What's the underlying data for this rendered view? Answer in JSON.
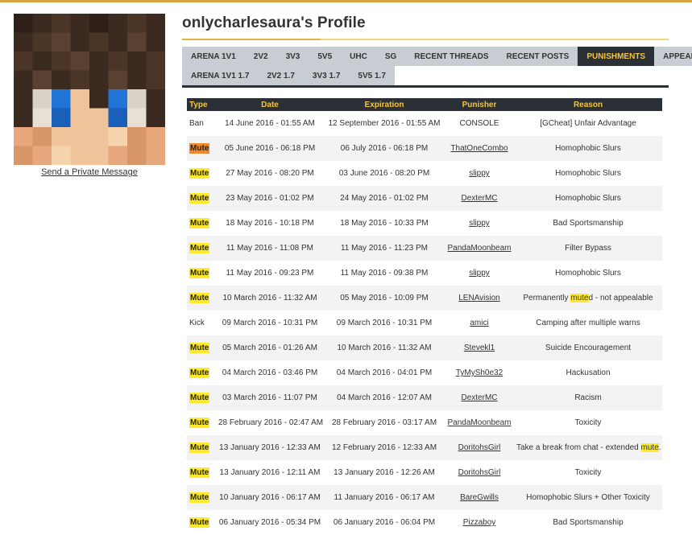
{
  "profile": {
    "title": "onlycharlesaura's Profile",
    "pm_link": "Send a Private Message"
  },
  "tabs_row1": [
    {
      "label": "ARENA 1V1",
      "active": false
    },
    {
      "label": "2V2",
      "active": false
    },
    {
      "label": "3V3",
      "active": false
    },
    {
      "label": "5V5",
      "active": false
    },
    {
      "label": "UHC",
      "active": false
    },
    {
      "label": "SG",
      "active": false
    },
    {
      "label": "RECENT THREADS",
      "active": false
    },
    {
      "label": "RECENT POSTS",
      "active": false
    },
    {
      "label": "PUNISHMENTS",
      "active": true
    },
    {
      "label": "APPEALS",
      "active": false
    }
  ],
  "tabs_row2": [
    {
      "label": "ARENA 1V1 1.7"
    },
    {
      "label": "2V2 1.7"
    },
    {
      "label": "3V3 1.7"
    },
    {
      "label": "5V5 1.7"
    }
  ],
  "table": {
    "headers": [
      "Type",
      "Date",
      "Expiration",
      "Punisher",
      "Reason"
    ],
    "rows": [
      {
        "type": "Ban",
        "date": "14 June 2016 - 01:55 AM",
        "expiration": "12 September 2016 - 01:55 AM",
        "punisher": "CONSOLE",
        "reason": "[GCheat] Unfair Advantage"
      },
      {
        "type": "Mute",
        "date": "05 June 2016 - 06:18 PM",
        "expiration": "06 July 2016 - 06:18 PM",
        "punisher": "ThatOneCombo",
        "reason": "Homophobic Slurs"
      },
      {
        "type": "Mute",
        "date": "27 May 2016 - 08:20 PM",
        "expiration": "03 June 2016 - 08:20 PM",
        "punisher": "slippy",
        "reason": "Homophobic Slurs"
      },
      {
        "type": "Mute",
        "date": "23 May 2016 - 01:02 PM",
        "expiration": "24 May 2016 - 01:02 PM",
        "punisher": "DexterMC",
        "reason": "Homophobic Slurs"
      },
      {
        "type": "Mute",
        "date": "18 May 2016 - 10:18 PM",
        "expiration": "18 May 2016 - 10:33 PM",
        "punisher": "slippy",
        "reason": "Bad Sportsmanship"
      },
      {
        "type": "Mute",
        "date": "11 May 2016 - 11:08 PM",
        "expiration": "11 May 2016 - 11:23 PM",
        "punisher": "PandaMoonbeam",
        "reason": "Filter Bypass"
      },
      {
        "type": "Mute",
        "date": "11 May 2016 - 09:23 PM",
        "expiration": "11 May 2016 - 09:38 PM",
        "punisher": "slippy",
        "reason": "Homophobic Slurs"
      },
      {
        "type": "Mute",
        "date": "10 March 2016 - 11:32 AM",
        "expiration": "05 May 2016 - 10:09 PM",
        "punisher": "LENAvision",
        "reason": "Permanently muted - not appealable"
      },
      {
        "type": "Kick",
        "date": "09 March 2016 - 10:31 PM",
        "expiration": "09 March 2016 - 10:31 PM",
        "punisher": "amici",
        "reason": "Camping after multiple warns"
      },
      {
        "type": "Mute",
        "date": "05 March 2016 - 01:26 AM",
        "expiration": "10 March 2016 - 11:32 AM",
        "punisher": "Stevekl1",
        "reason": "Suicide Encouragement"
      },
      {
        "type": "Mute",
        "date": "04 March 2016 - 03:46 PM",
        "expiration": "04 March 2016 - 04:01 PM",
        "punisher": "TyMySh0e32",
        "reason": "Hackusation"
      },
      {
        "type": "Mute",
        "date": "03 March 2016 - 11:07 PM",
        "expiration": "04 March 2016 - 12:07 AM",
        "punisher": "DexterMC",
        "reason": "Racism"
      },
      {
        "type": "Mute",
        "date": "28 February 2016 - 02:47 AM",
        "expiration": "28 February 2016 - 03:17 AM",
        "punisher": "PandaMoonbeam",
        "reason": "Toxicity"
      },
      {
        "type": "Mute",
        "date": "13 January 2016 - 12:33 AM",
        "expiration": "12 February 2016 - 12:33 AM",
        "punisher": "DoritohsGirl",
        "reason": "Take a break from chat - extended mute."
      },
      {
        "type": "Mute",
        "date": "13 January 2016 - 12:11 AM",
        "expiration": "13 January 2016 - 12:26 AM",
        "punisher": "DoritohsGirl",
        "reason": "Toxicity"
      },
      {
        "type": "Mute",
        "date": "10 January 2016 - 06:17 AM",
        "expiration": "11 January 2016 - 06:17 AM",
        "punisher": "BareGwills",
        "reason": "Homophobic Slurs + Other Toxicity"
      },
      {
        "type": "Mute",
        "date": "06 January 2016 - 05:34 PM",
        "expiration": "06 January 2016 - 06:04 PM",
        "punisher": "Pizzaboy",
        "reason": "Bad Sportsmanship"
      }
    ]
  },
  "colors": {
    "accent": "#f5c542",
    "dark": "#2b2f36",
    "tab_bg": "#c8cdd3",
    "highlight": "#ffe92b",
    "highlight_first": "#f08b2c"
  }
}
